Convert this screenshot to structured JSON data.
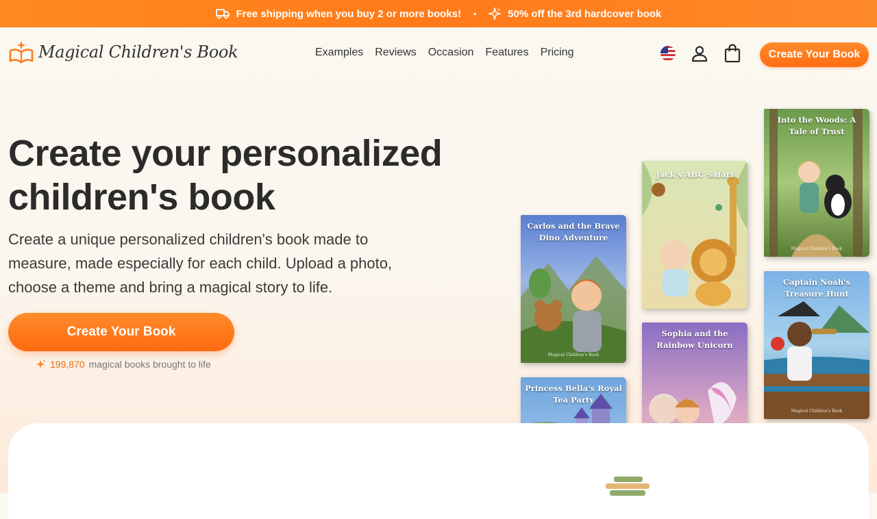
{
  "promo": {
    "left_text": "Free shipping when you buy 2 or more books!",
    "separator": "•",
    "right_text": "50% off the 3rd hardcover book"
  },
  "header": {
    "brand": "Magical Children's Book",
    "nav": [
      "Examples",
      "Reviews",
      "Occasion",
      "Features",
      "Pricing"
    ],
    "cta": "Create Your Book"
  },
  "hero": {
    "title": "Create your personalized children's book",
    "subtitle": "Create a unique personalized children's book made to measure, made especially for each child. Upload a photo, choose a theme and bring a magical story to life.",
    "cta": "Create Your Book",
    "counter_number": "199,870",
    "counter_text": "magical books brought to life"
  },
  "books": [
    {
      "title": "Carlos and the Brave Dino Adventure",
      "brand": "Magical Children's Book"
    },
    {
      "title": "Princess Bella's Royal Tea Party",
      "brand": ""
    },
    {
      "title": "Jack's ABC Safari",
      "brand": ""
    },
    {
      "title": "Sophia and the Rainbow Unicorn",
      "brand": ""
    },
    {
      "title": "Into the Woods: A Tale of Trust",
      "brand": "Magical Children's Book"
    },
    {
      "title": "Captain Noah's Treasure Hunt",
      "brand": "Magical Children's Book"
    }
  ],
  "colors": {
    "accent": "#ff7a1a",
    "text": "#2b2b2b",
    "background": "#fbf8f1"
  },
  "icons": [
    "truck-icon",
    "sparkle-icon",
    "book-logo-icon",
    "us-flag-icon",
    "user-icon",
    "shopping-bag-icon"
  ]
}
